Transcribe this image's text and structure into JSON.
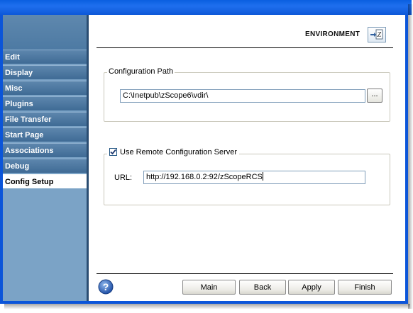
{
  "header": {
    "title": "ENVIRONMENT",
    "icon": "environment-icon"
  },
  "sidebar": {
    "items": [
      {
        "label": "Edit",
        "active": false
      },
      {
        "label": "Display",
        "active": false
      },
      {
        "label": "Misc",
        "active": false
      },
      {
        "label": "Plugins",
        "active": false
      },
      {
        "label": "File Transfer",
        "active": false
      },
      {
        "label": "Start Page",
        "active": false
      },
      {
        "label": "Associations",
        "active": false
      },
      {
        "label": "Debug",
        "active": false
      },
      {
        "label": "Config Setup",
        "active": true
      }
    ]
  },
  "config_path": {
    "legend": "Configuration Path",
    "value": "C:\\Inetpub\\zScope6\\vdir\\",
    "browse_label": "..."
  },
  "remote_config": {
    "checkbox_label": "Use Remote Configuration Server",
    "checked": true,
    "url_label": "URL:",
    "url_value": "http://192.168.0.2:92/zScopeRCS"
  },
  "footer": {
    "main_label": "Main",
    "back_label": "Back",
    "apply_label": "Apply",
    "finish_label": "Finish"
  },
  "colors": {
    "title_bar": "#0a5fe0",
    "sidebar_item": "#4f7aa3",
    "sidebar_bg": "#7ba3c6"
  }
}
